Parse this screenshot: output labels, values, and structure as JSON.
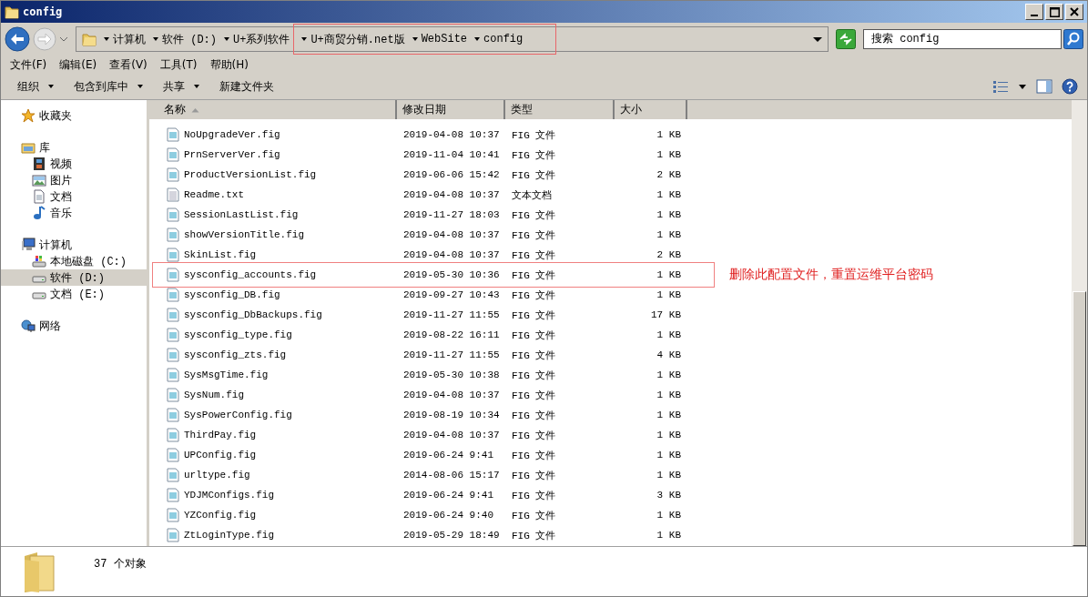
{
  "window": {
    "title": "config"
  },
  "address_bar": {
    "crumbs": [
      {
        "label": "计算机",
        "highlighted": false
      },
      {
        "label": "软件 (D:)",
        "highlighted": false
      },
      {
        "label": "U+系列软件",
        "highlighted": false
      },
      {
        "label": "U+商贸分销.net版",
        "highlighted": true
      },
      {
        "label": "WebSite",
        "highlighted": true
      },
      {
        "label": "config",
        "highlighted": true
      }
    ]
  },
  "search": {
    "placeholder": "搜索 config"
  },
  "menu": [
    "文件(F)",
    "编辑(E)",
    "查看(V)",
    "工具(T)",
    "帮助(H)"
  ],
  "toolbar": [
    {
      "label": "组织",
      "dropdown": true
    },
    {
      "label": "包含到库中",
      "dropdown": true
    },
    {
      "label": "共享",
      "dropdown": true
    },
    {
      "label": "新建文件夹",
      "dropdown": false
    }
  ],
  "sidebar": {
    "items": [
      {
        "label": "收藏夹",
        "kind": "favorites",
        "selected": false
      },
      {
        "label": "库",
        "kind": "library",
        "selected": false,
        "children": [
          {
            "label": "视频",
            "kind": "video",
            "selected": false
          },
          {
            "label": "图片",
            "kind": "picture",
            "selected": false
          },
          {
            "label": "文档",
            "kind": "document",
            "selected": false
          },
          {
            "label": "音乐",
            "kind": "music",
            "selected": false
          }
        ]
      },
      {
        "label": "计算机",
        "kind": "computer",
        "selected": false,
        "children": [
          {
            "label": "本地磁盘 (C:)",
            "kind": "system-drive",
            "selected": false
          },
          {
            "label": "软件 (D:)",
            "kind": "drive",
            "selected": true
          },
          {
            "label": "文档 (E:)",
            "kind": "drive",
            "selected": false
          }
        ]
      },
      {
        "label": "网络",
        "kind": "network",
        "selected": false
      }
    ]
  },
  "table": {
    "columns": [
      {
        "label": "名称",
        "sorted": true
      },
      {
        "label": "修改日期",
        "sorted": false
      },
      {
        "label": "类型",
        "sorted": false
      },
      {
        "label": "大小",
        "sorted": false
      }
    ],
    "rows": [
      {
        "kind": "file",
        "name": "NoUpgradeVer.fig",
        "modified": "2019-04-08 10:37",
        "type": "FIG 文件",
        "size": "1 KB",
        "highlighted": false
      },
      {
        "kind": "file",
        "name": "PrnServerVer.fig",
        "modified": "2019-11-04 10:41",
        "type": "FIG 文件",
        "size": "1 KB",
        "highlighted": false
      },
      {
        "kind": "file",
        "name": "ProductVersionList.fig",
        "modified": "2019-06-06 15:42",
        "type": "FIG 文件",
        "size": "2 KB",
        "highlighted": false
      },
      {
        "kind": "text",
        "name": "Readme.txt",
        "modified": "2019-04-08 10:37",
        "type": "文本文档",
        "size": "1 KB",
        "highlighted": false
      },
      {
        "kind": "file",
        "name": "SessionLastList.fig",
        "modified": "2019-11-27 18:03",
        "type": "FIG 文件",
        "size": "1 KB",
        "highlighted": false
      },
      {
        "kind": "file",
        "name": "showVersionTitle.fig",
        "modified": "2019-04-08 10:37",
        "type": "FIG 文件",
        "size": "1 KB",
        "highlighted": false
      },
      {
        "kind": "file",
        "name": "SkinList.fig",
        "modified": "2019-04-08 10:37",
        "type": "FIG 文件",
        "size": "2 KB",
        "highlighted": false
      },
      {
        "kind": "file",
        "name": "sysconfig_accounts.fig",
        "modified": "2019-05-30 10:36",
        "type": "FIG 文件",
        "size": "1 KB",
        "highlighted": true,
        "note": "删除此配置文件，重置运维平台密码"
      },
      {
        "kind": "file",
        "name": "sysconfig_DB.fig",
        "modified": "2019-09-27 10:43",
        "type": "FIG 文件",
        "size": "1 KB",
        "highlighted": false
      },
      {
        "kind": "file",
        "name": "sysconfig_DbBackups.fig",
        "modified": "2019-11-27 11:55",
        "type": "FIG 文件",
        "size": "17 KB",
        "highlighted": false
      },
      {
        "kind": "file",
        "name": "sysconfig_type.fig",
        "modified": "2019-08-22 16:11",
        "type": "FIG 文件",
        "size": "1 KB",
        "highlighted": false
      },
      {
        "kind": "file",
        "name": "sysconfig_zts.fig",
        "modified": "2019-11-27 11:55",
        "type": "FIG 文件",
        "size": "4 KB",
        "highlighted": false
      },
      {
        "kind": "file",
        "name": "SysMsgTime.fig",
        "modified": "2019-05-30 10:38",
        "type": "FIG 文件",
        "size": "1 KB",
        "highlighted": false
      },
      {
        "kind": "file",
        "name": "SysNum.fig",
        "modified": "2019-04-08 10:37",
        "type": "FIG 文件",
        "size": "1 KB",
        "highlighted": false
      },
      {
        "kind": "file",
        "name": "SysPowerConfig.fig",
        "modified": "2019-08-19 10:34",
        "type": "FIG 文件",
        "size": "1 KB",
        "highlighted": false
      },
      {
        "kind": "file",
        "name": "ThirdPay.fig",
        "modified": "2019-04-08 10:37",
        "type": "FIG 文件",
        "size": "1 KB",
        "highlighted": false
      },
      {
        "kind": "file",
        "name": "UPConfig.fig",
        "modified": "2019-06-24 9:41",
        "type": "FIG 文件",
        "size": "1 KB",
        "highlighted": false
      },
      {
        "kind": "file",
        "name": "urltype.fig",
        "modified": "2014-08-06 15:17",
        "type": "FIG 文件",
        "size": "1 KB",
        "highlighted": false
      },
      {
        "kind": "file",
        "name": "YDJMConfigs.fig",
        "modified": "2019-06-24 9:41",
        "type": "FIG 文件",
        "size": "3 KB",
        "highlighted": false
      },
      {
        "kind": "file",
        "name": "YZConfig.fig",
        "modified": "2019-06-24 9:40",
        "type": "FIG 文件",
        "size": "1 KB",
        "highlighted": false
      },
      {
        "kind": "file",
        "name": "ZtLoginType.fig",
        "modified": "2019-05-29 18:49",
        "type": "FIG 文件",
        "size": "1 KB",
        "highlighted": false
      }
    ]
  },
  "status_bar": {
    "text": "37 个对象"
  }
}
